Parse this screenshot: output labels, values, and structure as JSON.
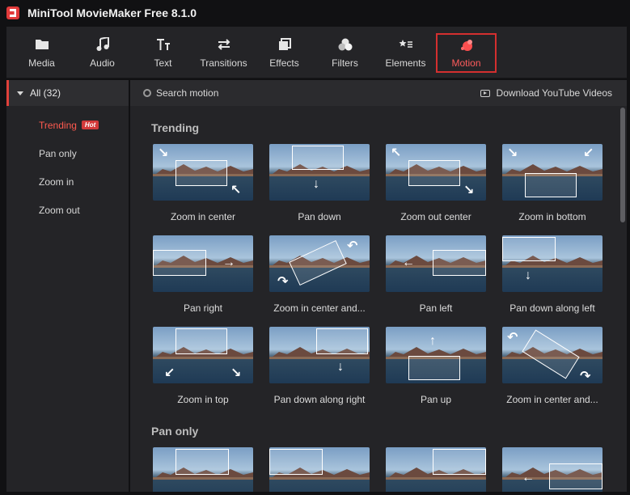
{
  "window": {
    "title": "MiniTool MovieMaker Free 8.1.0"
  },
  "toolbar": {
    "items": [
      {
        "label": "Media",
        "icon": "folder-icon"
      },
      {
        "label": "Audio",
        "icon": "music-note-icon"
      },
      {
        "label": "Text",
        "icon": "text-icon"
      },
      {
        "label": "Transitions",
        "icon": "swap-arrows-icon"
      },
      {
        "label": "Effects",
        "icon": "layers-icon"
      },
      {
        "label": "Filters",
        "icon": "circles-icon"
      },
      {
        "label": "Elements",
        "icon": "star-list-icon"
      },
      {
        "label": "Motion",
        "icon": "motion-dots-icon"
      }
    ],
    "active": "Motion",
    "accent_color": "#d42f2f"
  },
  "sidebar": {
    "all_label": "All (32)",
    "categories": [
      {
        "label": "Trending",
        "badge": "Hot"
      },
      {
        "label": "Pan only"
      },
      {
        "label": "Zoom in"
      },
      {
        "label": "Zoom out"
      }
    ]
  },
  "search": {
    "placeholder": "Search motion"
  },
  "download": {
    "label": "Download YouTube Videos"
  },
  "sections": [
    {
      "title": "Trending",
      "items": [
        "Zoom in center",
        "Pan down",
        "Zoom out center",
        "Zoom in bottom",
        "Pan right",
        "Zoom in center and...",
        "Pan left",
        "Pan down along left",
        "Zoom in top",
        "Pan down along right",
        "Pan up",
        "Zoom in center and..."
      ]
    },
    {
      "title": "Pan only",
      "items": [
        "",
        "",
        "",
        ""
      ]
    }
  ]
}
